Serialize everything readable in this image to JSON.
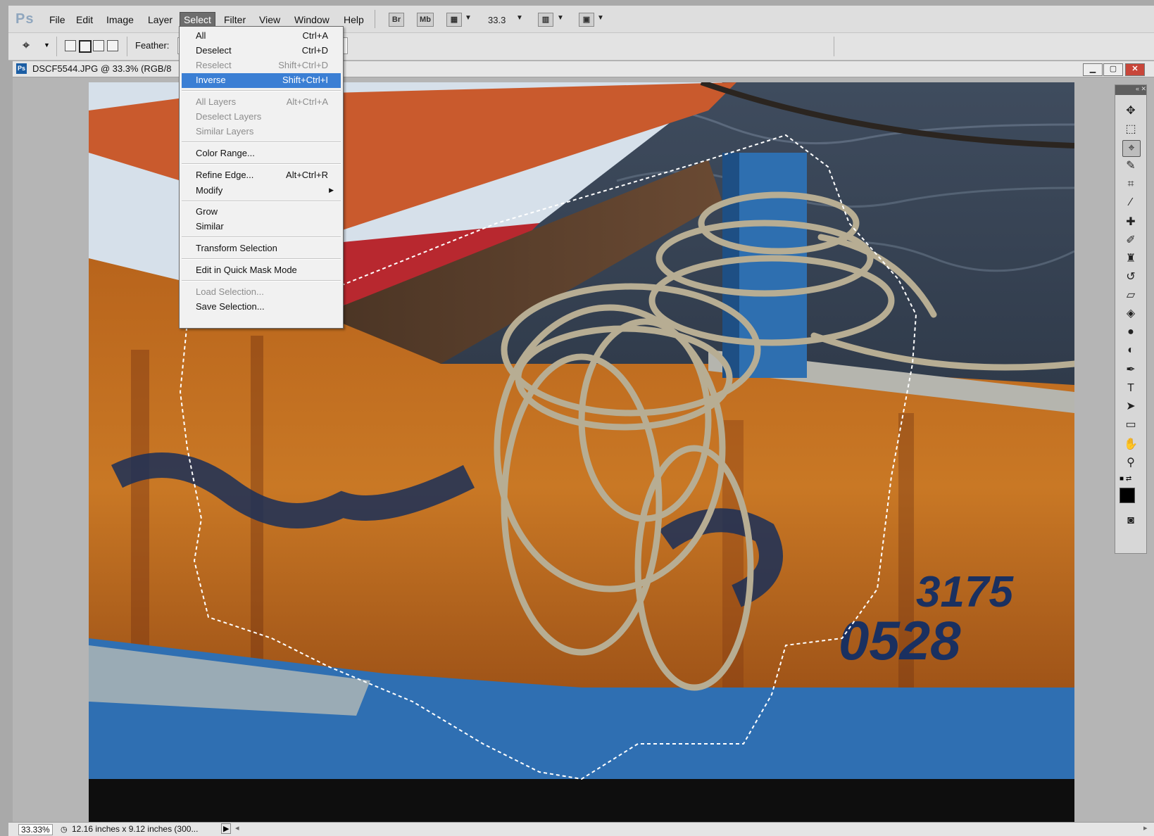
{
  "app": {
    "logo": "Ps"
  },
  "menubar": {
    "items": [
      "File",
      "Edit",
      "Image",
      "Layer",
      "Select",
      "Filter",
      "View",
      "Window",
      "Help"
    ],
    "active": "Select",
    "bridge_label": "Br",
    "minibridge_label": "Mb",
    "zoom_value": "33.3"
  },
  "options": {
    "feather_label": "Feather:"
  },
  "document": {
    "title": "DSCF5544.JPG @ 33.3% (RGB/8"
  },
  "select_menu": {
    "all": {
      "label": "All",
      "shortcut": "Ctrl+A"
    },
    "deselect": {
      "label": "Deselect",
      "shortcut": "Ctrl+D"
    },
    "reselect": {
      "label": "Reselect",
      "shortcut": "Shift+Ctrl+D"
    },
    "inverse": {
      "label": "Inverse",
      "shortcut": "Shift+Ctrl+I"
    },
    "all_layers": {
      "label": "All Layers",
      "shortcut": "Alt+Ctrl+A"
    },
    "deselect_layers": {
      "label": "Deselect Layers"
    },
    "similar_layers": {
      "label": "Similar Layers"
    },
    "color_range": {
      "label": "Color Range..."
    },
    "refine_edge": {
      "label": "Refine Edge...",
      "shortcut": "Alt+Ctrl+R"
    },
    "modify": {
      "label": "Modify"
    },
    "grow": {
      "label": "Grow"
    },
    "similar": {
      "label": "Similar"
    },
    "transform_selection": {
      "label": "Transform Selection"
    },
    "quick_mask": {
      "label": "Edit in Quick Mask Mode"
    },
    "load_selection": {
      "label": "Load Selection..."
    },
    "save_selection": {
      "label": "Save Selection..."
    }
  },
  "canvas": {
    "boat_number_line1": "3175",
    "boat_number_line2": "0528"
  },
  "status": {
    "zoom": "33.33%",
    "doc_size": "12.16 inches x 9.12 inches (300..."
  },
  "colors": {
    "menu_highlight": "#3b7fd4",
    "ps_blue": "#1c5ea4",
    "boat_orange": "#c4681e",
    "boat_blue": "#2f6fb2"
  }
}
